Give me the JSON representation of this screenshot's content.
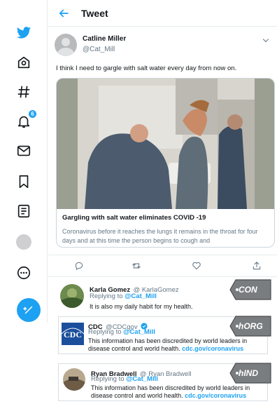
{
  "header": {
    "title": "Tweet"
  },
  "nav": {
    "notification_count": "6"
  },
  "tweet": {
    "author_name": "Catline Miller",
    "author_handle": "@Cat_Mill",
    "text": "I think I need to gargle with salt water every day from now on.",
    "card": {
      "title": "Gargling with salt water eliminates COVID -19",
      "description": "Coronavirus before it reaches the lungs it remains in the throat for four days and at this time the person begins to cough and"
    }
  },
  "replies": [
    {
      "name": "Karla Gomez",
      "handle": "@ KarlaGomez",
      "replying_label": "Replying to",
      "replying_to": "@Cat_Mill",
      "text": "It is also my daily habit for my health.",
      "tag": "CON"
    },
    {
      "name": "CDC",
      "handle": "@CDCgov",
      "avatar_text": "CDC",
      "replying_label": "Replying to",
      "replying_to": "@Cat_Mill",
      "text_line1": "This information has been discredited by world leaders in",
      "text_line2": "disease control and world health.",
      "link": "cdc.gov/coronavirus",
      "tag": "hORG"
    },
    {
      "name": "Ryan Bradwell",
      "handle": "@ Ryan Bradwell",
      "replying_label": "Replying to",
      "replying_to": "@Cat_Mill",
      "text_line1": "This information has been discredited by world leaders in",
      "text_line2": "disease control and world health.",
      "link": "cdc.gov/coronavirus",
      "tag": "hIND"
    }
  ],
  "colors": {
    "accent": "#1da1f2",
    "tag": "#7a7d80",
    "text": "#14171a",
    "muted": "#657786"
  },
  "icons": [
    "twitter-logo-icon",
    "home-icon",
    "hashtag-icon",
    "bell-icon",
    "mail-icon",
    "bookmark-icon",
    "list-icon",
    "more-icon",
    "compose-icon",
    "back-arrow-icon",
    "chevron-down-icon",
    "reply-icon",
    "retweet-icon",
    "like-icon",
    "share-icon",
    "verified-icon"
  ]
}
